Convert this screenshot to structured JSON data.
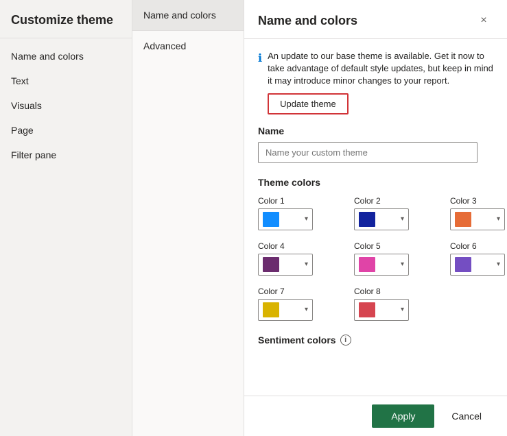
{
  "sidebar_left": {
    "header": "Customize theme",
    "nav_items": [
      {
        "id": "name-and-colors",
        "label": "Name and colors"
      },
      {
        "id": "text",
        "label": "Text"
      },
      {
        "id": "visuals",
        "label": "Visuals"
      },
      {
        "id": "page",
        "label": "Page"
      },
      {
        "id": "filter-pane",
        "label": "Filter pane"
      }
    ]
  },
  "sidebar_middle": {
    "items": [
      {
        "id": "name-and-colors",
        "label": "Name and colors",
        "active": true
      },
      {
        "id": "advanced",
        "label": "Advanced",
        "active": false
      }
    ]
  },
  "main": {
    "header": {
      "title": "Name and colors",
      "close_label": "×"
    },
    "info_banner": {
      "text": "An update to our base theme is available. Get it now to take advantage of default style updates, but keep in mind it may introduce minor changes to your report.",
      "icon": "ℹ"
    },
    "update_theme_btn": "Update theme",
    "name_section": {
      "label": "Name",
      "placeholder": "Name your custom theme"
    },
    "theme_colors": {
      "label": "Theme colors",
      "colors": [
        {
          "id": "color1",
          "label": "Color 1",
          "value": "#118DFF"
        },
        {
          "id": "color2",
          "label": "Color 2",
          "value": "#12239E"
        },
        {
          "id": "color3",
          "label": "Color 3",
          "value": "#E66C37"
        },
        {
          "id": "color4",
          "label": "Color 4",
          "value": "#6B2C6E"
        },
        {
          "id": "color5",
          "label": "Color 5",
          "value": "#E044A7"
        },
        {
          "id": "color6",
          "label": "Color 6",
          "value": "#744EC2"
        },
        {
          "id": "color7",
          "label": "Color 7",
          "value": "#D9B300"
        },
        {
          "id": "color8",
          "label": "Color 8",
          "value": "#D64550"
        }
      ]
    },
    "sentiment_colors": {
      "label": "Sentiment colors"
    },
    "footer": {
      "apply_label": "Apply",
      "cancel_label": "Cancel"
    }
  }
}
